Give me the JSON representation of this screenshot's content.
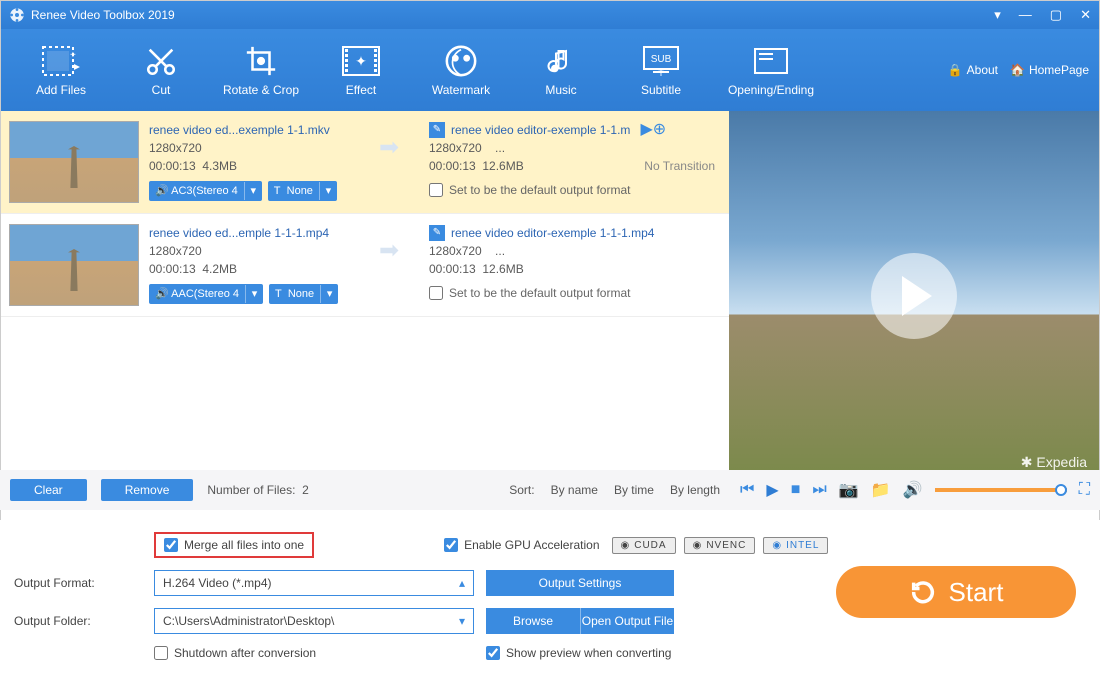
{
  "app": {
    "title": "Renee Video Toolbox 2019"
  },
  "toolbar": {
    "items": [
      {
        "label": "Add Files",
        "icon": "filmstrip"
      },
      {
        "label": "Cut",
        "icon": "scissors"
      },
      {
        "label": "Rotate & Crop",
        "icon": "crop"
      },
      {
        "label": "Effect",
        "icon": "effect"
      },
      {
        "label": "Watermark",
        "icon": "watermark"
      },
      {
        "label": "Music",
        "icon": "music"
      },
      {
        "label": "Subtitle",
        "icon": "subtitle"
      },
      {
        "label": "Opening/Ending",
        "icon": "card"
      }
    ],
    "about": "About",
    "homepage": "HomePage"
  },
  "files": [
    {
      "in": {
        "name": "renee video ed...exemple 1-1.mkv",
        "res": "1280x720",
        "dur": "00:00:13",
        "size": "4.3MB",
        "aud": "AC3(Stereo 4",
        "sub": "None"
      },
      "out": {
        "name": "renee video editor-exemple 1-1.m",
        "res": "1280x720",
        "dots": "...",
        "dur": "00:00:13",
        "size": "12.6MB",
        "trans": "No Transition"
      },
      "default": false,
      "selected": true
    },
    {
      "in": {
        "name": "renee video ed...emple 1-1-1.mp4",
        "res": "1280x720",
        "dur": "00:00:13",
        "size": "4.2MB",
        "aud": "AAC(Stereo 4",
        "sub": "None"
      },
      "out": {
        "name": "renee video editor-exemple 1-1-1.mp4",
        "res": "1280x720",
        "dots": "...",
        "dur": "00:00:13",
        "size": "12.6MB",
        "trans": ""
      },
      "default": false,
      "selected": false
    }
  ],
  "defaultLabel": "Set to be the default output format",
  "preview": {
    "watermark": "Expedia"
  },
  "mid": {
    "clear": "Clear",
    "remove": "Remove",
    "countLabel": "Number of Files:",
    "count": "2",
    "sortLabel": "Sort:",
    "by": [
      "By name",
      "By time",
      "By length"
    ]
  },
  "bottom": {
    "merge": "Merge all files into one",
    "mergeChecked": true,
    "gpu": "Enable GPU Acceleration",
    "gpuChecked": true,
    "badges": [
      "CUDA",
      "NVENC",
      "INTEL"
    ],
    "formatLabel": "Output Format:",
    "formatValue": "H.264 Video (*.mp4)",
    "outputSettings": "Output Settings",
    "folderLabel": "Output Folder:",
    "folderValue": "C:\\Users\\Administrator\\Desktop\\",
    "browse": "Browse",
    "openFolder": "Open Output File",
    "shutdown": "Shutdown after conversion",
    "shutdownChecked": false,
    "showPreview": "Show preview when converting",
    "showPreviewChecked": true,
    "start": "Start"
  }
}
